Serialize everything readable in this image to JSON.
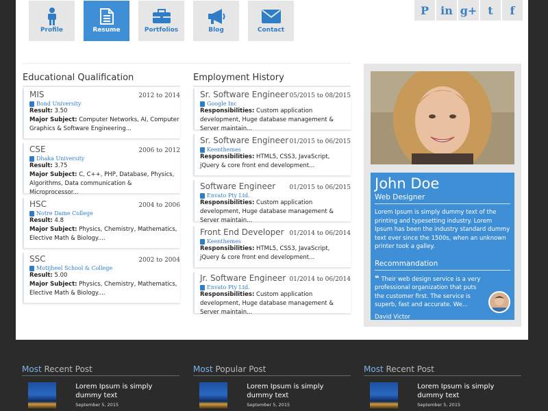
{
  "nav": {
    "tabs": [
      {
        "label": "Profile",
        "icon": "person-icon"
      },
      {
        "label": "Resume",
        "icon": "resume-icon",
        "active": true
      },
      {
        "label": "Portfolios",
        "icon": "briefcase-icon"
      },
      {
        "label": "Blog",
        "icon": "megaphone-icon"
      },
      {
        "label": "Contact",
        "icon": "envelope-icon"
      }
    ]
  },
  "social": [
    {
      "glyph": "P",
      "icon": "pinterest-icon"
    },
    {
      "glyph": "in",
      "icon": "linkedin-icon"
    },
    {
      "glyph": "g+",
      "icon": "googleplus-icon"
    },
    {
      "glyph": "t",
      "icon": "twitter-icon"
    },
    {
      "glyph": "f",
      "icon": "facebook-icon"
    }
  ],
  "education": {
    "title": "Educational Qualification",
    "items": [
      {
        "degree": "MIS",
        "years": "2012 to 2014",
        "institution": "Bond University",
        "result_label": "Result:",
        "result": "3.50",
        "subject_label": "Major Subject:",
        "subject": "Computer Networks, AI, Computer Graphics & Software Engineering..."
      },
      {
        "degree": "CSE",
        "years": "2006 to 2012",
        "institution": "Dhaka University",
        "result_label": "Result:",
        "result": "3.75",
        "subject_label": "Major Subject:",
        "subject": "C, C++, PHP, Database, Physics, Algorithms, Data communication & Microprocessor..."
      },
      {
        "degree": "HSC",
        "years": "2004 to 2006",
        "institution": "Notre Dame College",
        "result_label": "Result:",
        "result": "4.8",
        "subject_label": "Major Subject:",
        "subject": "Physics, Chemistry, Mathematics, Elective Math & Biology...."
      },
      {
        "degree": "SSC",
        "years": "2002 to 2004",
        "institution": "Motijheel School & College",
        "result_label": "Result:",
        "result": "5.00",
        "subject_label": "Major Subject:",
        "subject": "Physics, Chemistry, Mathematics, Elective Math & Biology...."
      }
    ]
  },
  "employment": {
    "title": "Employment History",
    "items": [
      {
        "position": "Sr. Software Engineer",
        "period": "05/2015 to 08/2015",
        "company": "Google Inc",
        "resp_label": "Responsibilities:",
        "resp": "Custom application development, Huge database management & Server maintain..."
      },
      {
        "position": "Sr. Software Engineer",
        "period": "01/2015 to 06/2015",
        "company": "Keenthemes",
        "resp_label": "Responsibilities:",
        "resp": "HTML5, CSS3, JavaScript, jQuery & core front end development..."
      },
      {
        "position": "Software Engineer",
        "period": "01/2015 to 06/2015",
        "company": "Envato Pty Ltd.",
        "resp_label": "Responsibilities:",
        "resp": "Custom application development, Huge database management & Server maintain..."
      },
      {
        "position": "Front End Developer",
        "period": "01/2014 to 06/2014",
        "company": "Keenthemes",
        "resp_label": "Responsibilities:",
        "resp": "HTML5, CSS3, JavaScript, jQuery & core front end development..."
      },
      {
        "position": "Jr. Software Engineer",
        "period": "01/2014 to 06/2014",
        "company": "Envato Pty Ltd.",
        "resp_label": "Responsibilities:",
        "resp": "Custom application development, Huge database management & Server maintain..."
      }
    ]
  },
  "profile": {
    "name": "John Doe",
    "role": "Web Designer",
    "description": "Lorem Ipsum is simply dummy text of the printing and typesetting industry. Lorem Ipsum has been the industry standard dummy text ever since the 1500s, when an unknown printer took a galley.",
    "recommendation_title": "Recommandation",
    "quote": "Their web design service is a very professional organization that puts the customer first. The service is superb, fast and accurate. We...",
    "quote_author": "David Victor"
  },
  "footer": {
    "columns": [
      {
        "title_a": "Most",
        "title_b": " Recent Post",
        "post_title": "Lorem Ipsum is simply dummy text",
        "post_date": "September 5, 2015"
      },
      {
        "title_a": "Most",
        "title_b": " Popular Post",
        "post_title": "Lorem Ipsum is simply dummy text",
        "post_date": "September 5, 2015"
      },
      {
        "title_a": "Most",
        "title_b": " Recent Post",
        "post_title": "Lorem Ipsum is simply dummy text",
        "post_date": "September 5, 2015"
      }
    ]
  },
  "colors": {
    "accent": "#3f8fd6",
    "tab_bg": "#e6e6e6",
    "footer_bg": "#2b2b2b"
  }
}
